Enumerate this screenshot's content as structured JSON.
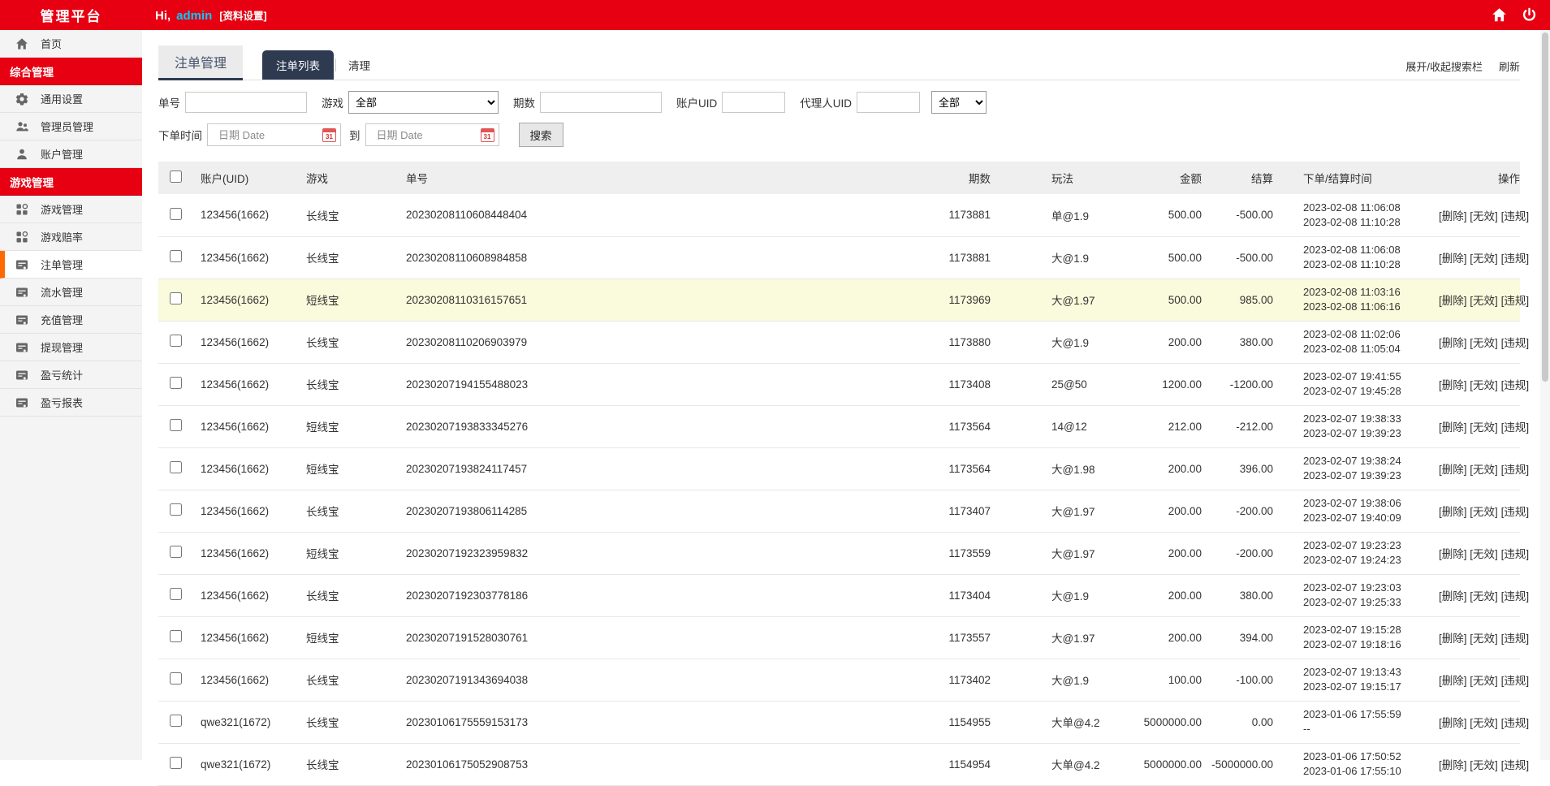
{
  "header": {
    "brand": "管理平台",
    "greeting_prefix": "Hi,",
    "username": "admin",
    "profile_link": "[资料设置]"
  },
  "colors": {
    "primary_red": "#e60012",
    "username_cyan": "#00ccff",
    "active_tab_navy": "#2e3a50",
    "active_item_orange": "#ff6a00",
    "row_highlight": "#fafadc"
  },
  "sidebar": {
    "items": [
      {
        "type": "item",
        "label": "首页",
        "icon": "home-icon"
      },
      {
        "type": "section",
        "label": "综合管理"
      },
      {
        "type": "item",
        "label": "通用设置",
        "icon": "gear-icon"
      },
      {
        "type": "item",
        "label": "管理员管理",
        "icon": "users-icon"
      },
      {
        "type": "item",
        "label": "账户管理",
        "icon": "user-icon"
      },
      {
        "type": "section",
        "label": "游戏管理"
      },
      {
        "type": "item",
        "label": "游戏管理",
        "icon": "grid-icon"
      },
      {
        "type": "item",
        "label": "游戏赔率",
        "icon": "grid-icon"
      },
      {
        "type": "item",
        "label": "注单管理",
        "icon": "doc-icon",
        "active": true
      },
      {
        "type": "item",
        "label": "流水管理",
        "icon": "doc-icon"
      },
      {
        "type": "item",
        "label": "充值管理",
        "icon": "doc-icon"
      },
      {
        "type": "item",
        "label": "提现管理",
        "icon": "doc-icon"
      },
      {
        "type": "item",
        "label": "盈亏统计",
        "icon": "doc-icon"
      },
      {
        "type": "item",
        "label": "盈亏报表",
        "icon": "doc-icon"
      }
    ]
  },
  "page": {
    "title": "注单管理",
    "tabs": [
      {
        "label": "注单列表",
        "active": true
      },
      {
        "label": "清理",
        "active": false
      }
    ],
    "toggle_search": "展开/收起搜索栏",
    "refresh": "刷新"
  },
  "search": {
    "order_no_label": "单号",
    "game_label": "游戏",
    "game_value": "全部",
    "period_label": "期数",
    "account_uid_label": "账户UID",
    "agent_uid_label": "代理人UID",
    "status_value": "全部",
    "time_label": "下单时间",
    "to_label": "到",
    "date_placeholder": "日期 Date",
    "calendar_day": "31",
    "submit_label": "搜索"
  },
  "table": {
    "columns": [
      "账户(UID)",
      "游戏",
      "单号",
      "期数",
      "玩法",
      "金额",
      "结算",
      "下单/结算时间",
      "操作"
    ],
    "actions": [
      "[删除]",
      "[无效]",
      "[违规]"
    ],
    "rows": [
      {
        "account": "123456(1662)",
        "game": "长线宝",
        "order": "20230208110608448404",
        "period": "1173881",
        "play": "单@1.9",
        "amount": "500.00",
        "settle": "-500.00",
        "time1": "2023-02-08 11:06:08",
        "time2": "2023-02-08 11:10:28",
        "highlight": false
      },
      {
        "account": "123456(1662)",
        "game": "长线宝",
        "order": "20230208110608984858",
        "period": "1173881",
        "play": "大@1.9",
        "amount": "500.00",
        "settle": "-500.00",
        "time1": "2023-02-08 11:06:08",
        "time2": "2023-02-08 11:10:28",
        "highlight": false
      },
      {
        "account": "123456(1662)",
        "game": "短线宝",
        "order": "20230208110316157651",
        "period": "1173969",
        "play": "大@1.97",
        "amount": "500.00",
        "settle": "985.00",
        "time1": "2023-02-08 11:03:16",
        "time2": "2023-02-08 11:06:16",
        "highlight": true
      },
      {
        "account": "123456(1662)",
        "game": "长线宝",
        "order": "20230208110206903979",
        "period": "1173880",
        "play": "大@1.9",
        "amount": "200.00",
        "settle": "380.00",
        "time1": "2023-02-08 11:02:06",
        "time2": "2023-02-08 11:05:04",
        "highlight": false
      },
      {
        "account": "123456(1662)",
        "game": "长线宝",
        "order": "20230207194155488023",
        "period": "1173408",
        "play": "25@50",
        "amount": "1200.00",
        "settle": "-1200.00",
        "time1": "2023-02-07 19:41:55",
        "time2": "2023-02-07 19:45:28",
        "highlight": false
      },
      {
        "account": "123456(1662)",
        "game": "短线宝",
        "order": "20230207193833345276",
        "period": "1173564",
        "play": "14@12",
        "amount": "212.00",
        "settle": "-212.00",
        "time1": "2023-02-07 19:38:33",
        "time2": "2023-02-07 19:39:23",
        "highlight": false
      },
      {
        "account": "123456(1662)",
        "game": "短线宝",
        "order": "20230207193824117457",
        "period": "1173564",
        "play": "大@1.98",
        "amount": "200.00",
        "settle": "396.00",
        "time1": "2023-02-07 19:38:24",
        "time2": "2023-02-07 19:39:23",
        "highlight": false
      },
      {
        "account": "123456(1662)",
        "game": "长线宝",
        "order": "20230207193806114285",
        "period": "1173407",
        "play": "大@1.97",
        "amount": "200.00",
        "settle": "-200.00",
        "time1": "2023-02-07 19:38:06",
        "time2": "2023-02-07 19:40:09",
        "highlight": false
      },
      {
        "account": "123456(1662)",
        "game": "短线宝",
        "order": "20230207192323959832",
        "period": "1173559",
        "play": "大@1.97",
        "amount": "200.00",
        "settle": "-200.00",
        "time1": "2023-02-07 19:23:23",
        "time2": "2023-02-07 19:24:23",
        "highlight": false
      },
      {
        "account": "123456(1662)",
        "game": "长线宝",
        "order": "20230207192303778186",
        "period": "1173404",
        "play": "大@1.9",
        "amount": "200.00",
        "settle": "380.00",
        "time1": "2023-02-07 19:23:03",
        "time2": "2023-02-07 19:25:33",
        "highlight": false
      },
      {
        "account": "123456(1662)",
        "game": "短线宝",
        "order": "20230207191528030761",
        "period": "1173557",
        "play": "大@1.97",
        "amount": "200.00",
        "settle": "394.00",
        "time1": "2023-02-07 19:15:28",
        "time2": "2023-02-07 19:18:16",
        "highlight": false
      },
      {
        "account": "123456(1662)",
        "game": "长线宝",
        "order": "20230207191343694038",
        "period": "1173402",
        "play": "大@1.9",
        "amount": "100.00",
        "settle": "-100.00",
        "time1": "2023-02-07 19:13:43",
        "time2": "2023-02-07 19:15:17",
        "highlight": false
      },
      {
        "account": "qwe321(1672)",
        "game": "长线宝",
        "order": "20230106175559153173",
        "period": "1154955",
        "play": "大单@4.2",
        "amount": "5000000.00",
        "settle": "0.00",
        "time1": "2023-01-06 17:55:59",
        "time2": "--",
        "highlight": false
      },
      {
        "account": "qwe321(1672)",
        "game": "长线宝",
        "order": "20230106175052908753",
        "period": "1154954",
        "play": "大单@4.2",
        "amount": "5000000.00",
        "settle": "-5000000.00",
        "time1": "2023-01-06 17:50:52",
        "time2": "2023-01-06 17:55:10",
        "highlight": false
      }
    ]
  }
}
